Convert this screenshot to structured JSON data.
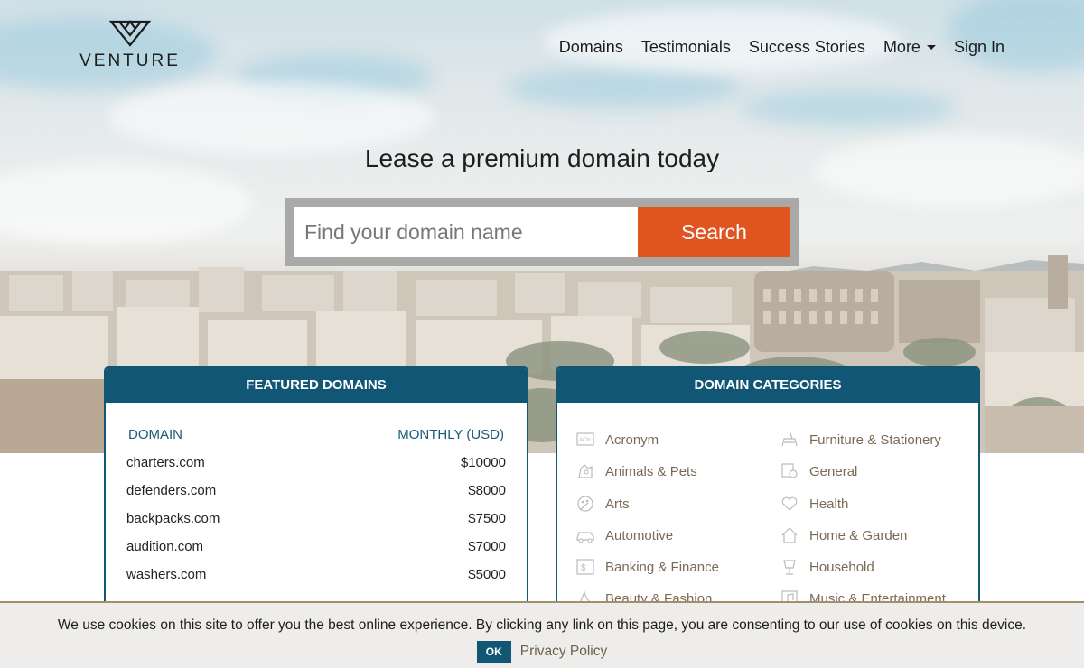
{
  "brand": {
    "name": "VENTURE"
  },
  "nav": {
    "items": [
      "Domains",
      "Testimonials",
      "Success Stories",
      "More",
      "Sign In"
    ]
  },
  "hero": {
    "tagline": "Lease a premium domain today",
    "search_placeholder": "Find your domain name",
    "search_button": "Search"
  },
  "featured": {
    "title": "FEATURED DOMAINS",
    "col_domain": "DOMAIN",
    "col_price": "MONTHLY (USD)",
    "rows": [
      {
        "domain": "charters.com",
        "price": "$10000"
      },
      {
        "domain": "defenders.com",
        "price": "$8000"
      },
      {
        "domain": "backpacks.com",
        "price": "$7500"
      },
      {
        "domain": "audition.com",
        "price": "$7000"
      },
      {
        "domain": "washers.com",
        "price": "$5000"
      }
    ]
  },
  "categories": {
    "title": "DOMAIN CATEGORIES",
    "left": [
      {
        "label": "Acronym",
        "icon": "acronym-icon"
      },
      {
        "label": "Animals & Pets",
        "icon": "animals-icon"
      },
      {
        "label": "Arts",
        "icon": "arts-icon"
      },
      {
        "label": "Automotive",
        "icon": "automotive-icon"
      },
      {
        "label": "Banking & Finance",
        "icon": "banking-icon"
      },
      {
        "label": "Beauty & Fashion",
        "icon": "beauty-icon"
      }
    ],
    "right": [
      {
        "label": "Furniture & Stationery",
        "icon": "furniture-icon"
      },
      {
        "label": "General",
        "icon": "general-icon"
      },
      {
        "label": "Health",
        "icon": "health-icon"
      },
      {
        "label": "Home & Garden",
        "icon": "home-icon"
      },
      {
        "label": "Household",
        "icon": "household-icon"
      },
      {
        "label": "Music & Entertainment",
        "icon": "music-icon"
      }
    ]
  },
  "cookie": {
    "text": "We use cookies on this site to offer you the best online experience. By clicking any link on this page, you are consenting to our use of cookies on this device.",
    "ok": "OK",
    "privacy": "Privacy Policy"
  },
  "colors": {
    "accent": "#e0541f",
    "brand": "#115675",
    "category_text": "#7a6a55"
  }
}
